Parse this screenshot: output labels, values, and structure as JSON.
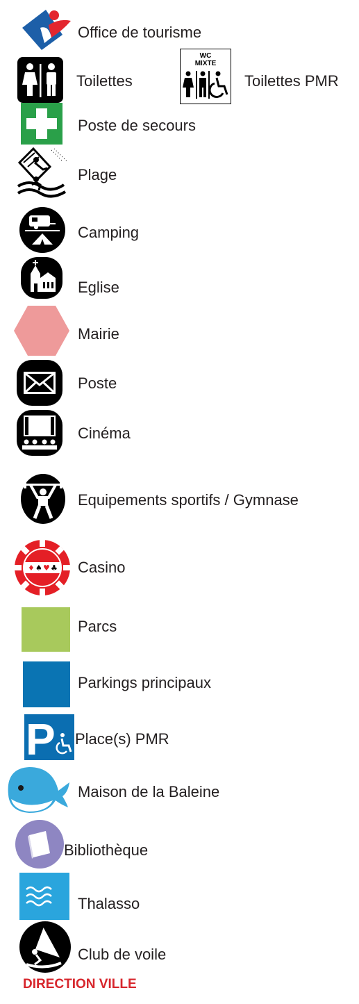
{
  "legend": {
    "items": [
      {
        "key": "tourism",
        "label": "Office de tourisme",
        "icon": "tourism-office-icon"
      },
      {
        "key": "toilets",
        "label": "Toilettes",
        "icon": "toilets-icon"
      },
      {
        "key": "toilets_pmr",
        "label": "Toilettes PMR",
        "icon": "accessible-toilets-icon",
        "sign_text": [
          "WC",
          "MIXTE"
        ]
      },
      {
        "key": "first_aid",
        "label": "Poste de secours",
        "icon": "first-aid-icon"
      },
      {
        "key": "beach",
        "label": "Plage",
        "icon": "beach-icon"
      },
      {
        "key": "camping",
        "label": "Camping",
        "icon": "camping-icon"
      },
      {
        "key": "church",
        "label": "Eglise",
        "icon": "church-icon"
      },
      {
        "key": "town_hall",
        "label": "Mairie",
        "icon": "hexagon-icon"
      },
      {
        "key": "post",
        "label": "Poste",
        "icon": "envelope-icon"
      },
      {
        "key": "cinema",
        "label": "Cinéma",
        "icon": "cinema-icon"
      },
      {
        "key": "sports",
        "label": "Equipements sportifs / Gymnase",
        "icon": "weightlifter-icon"
      },
      {
        "key": "casino",
        "label": "Casino",
        "icon": "casino-chip-icon"
      },
      {
        "key": "parks",
        "label": "Parcs",
        "icon": "green-square-icon"
      },
      {
        "key": "parking",
        "label": "Parkings principaux",
        "icon": "blue-square-icon"
      },
      {
        "key": "pmr_place",
        "label": "Place(s) PMR",
        "icon": "accessible-parking-icon"
      },
      {
        "key": "whale",
        "label": "Maison de la Baleine",
        "icon": "whale-icon"
      },
      {
        "key": "library",
        "label": "Bibliothèque",
        "icon": "book-icon"
      },
      {
        "key": "thalasso",
        "label": "Thalasso",
        "icon": "waves-icon"
      },
      {
        "key": "sailing",
        "label": "Club de voile",
        "icon": "windsurf-icon"
      }
    ],
    "direction_label": "DIRECTION VILLE"
  },
  "colors": {
    "text": "#231f20",
    "black": "#000000",
    "first_aid_green": "#2aa049",
    "tourism_blue": "#1d5fa8",
    "tourism_red": "#e3262f",
    "town_hall_pink": "#ee9a9a",
    "casino_red": "#e41f26",
    "parks_green": "#a8c95c",
    "parking_blue": "#0a74b3",
    "pmr_blue": "#0b6eb1",
    "whale_blue": "#3aa9dc",
    "library_purple": "#8e86c2",
    "thalasso_blue": "#2aa5dd",
    "direction_red": "#d7262c"
  }
}
